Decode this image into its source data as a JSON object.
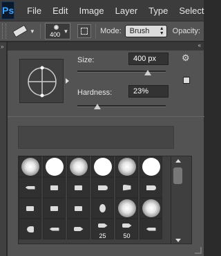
{
  "app": {
    "logo": "Ps"
  },
  "menu": [
    "File",
    "Edit",
    "Image",
    "Layer",
    "Type",
    "Select"
  ],
  "options": {
    "brush_size_display": "400",
    "mode_label": "Mode:",
    "mode_value": "Brush",
    "opacity_label": "Opacity:"
  },
  "brush_panel": {
    "size_label": "Size:",
    "size_value": "400 px",
    "size_fraction": 0.8,
    "hardness_label": "Hardness:",
    "hardness_value": "23%",
    "hardness_fraction": 0.23
  },
  "presets": {
    "tiles": [
      {
        "kind": "soft",
        "label": ""
      },
      {
        "kind": "hard",
        "label": ""
      },
      {
        "kind": "soft",
        "label": ""
      },
      {
        "kind": "hard",
        "label": ""
      },
      {
        "kind": "soft",
        "label": ""
      },
      {
        "kind": "hard",
        "label": ""
      },
      {
        "kind": "tip-a",
        "label": ""
      },
      {
        "kind": "tip-b",
        "label": ""
      },
      {
        "kind": "tip-b",
        "label": ""
      },
      {
        "kind": "tip-c",
        "label": ""
      },
      {
        "kind": "tip-e",
        "label": ""
      },
      {
        "kind": "tip-c",
        "label": ""
      },
      {
        "kind": "tip-b",
        "label": ""
      },
      {
        "kind": "tip-b",
        "label": ""
      },
      {
        "kind": "tip-b",
        "label": ""
      },
      {
        "kind": "tip-f",
        "label": ""
      },
      {
        "kind": "soft",
        "label": ""
      },
      {
        "kind": "soft",
        "label": ""
      },
      {
        "kind": "tip-d",
        "label": ""
      },
      {
        "kind": "tip-a",
        "label": ""
      },
      {
        "kind": "tip-g",
        "label": ""
      },
      {
        "kind": "tip-g",
        "label": "25"
      },
      {
        "kind": "tip-g",
        "label": "50"
      },
      {
        "kind": "tip-a",
        "label": ""
      }
    ]
  },
  "colors": {
    "menubar_bg": "#3c3c3c",
    "panel_bg": "#535353",
    "ps_logo_text": "#3fa3ff"
  }
}
